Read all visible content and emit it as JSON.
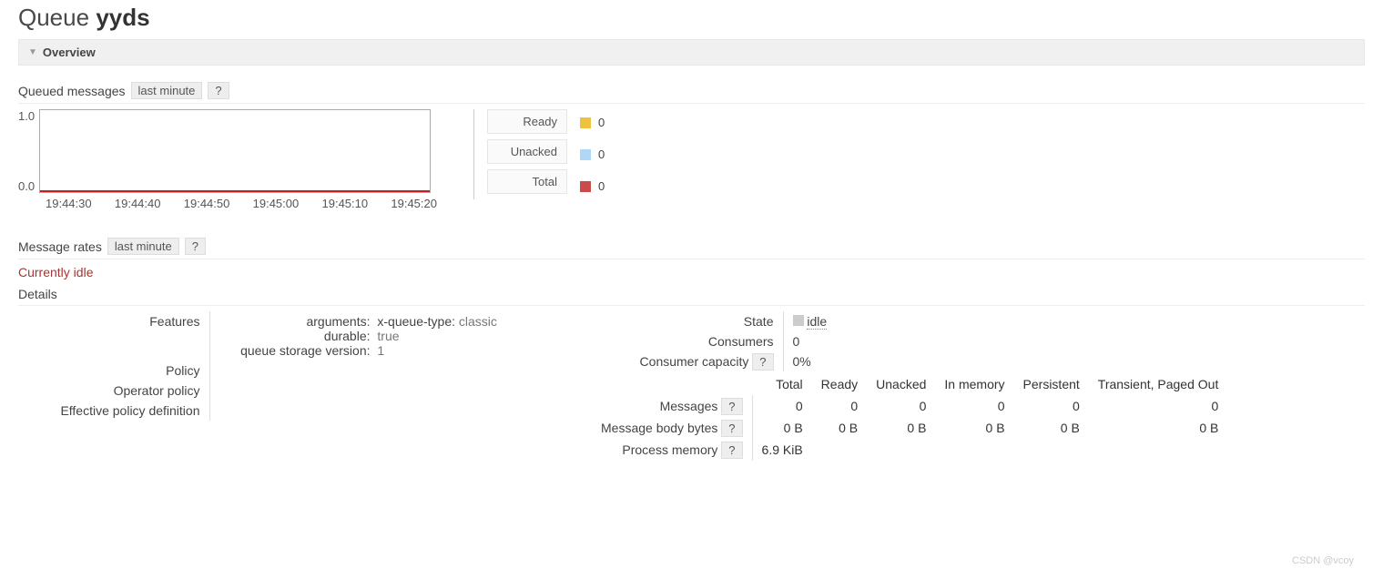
{
  "page": {
    "title_prefix": "Queue",
    "queue_name": "yyds",
    "section_overview": "Overview"
  },
  "queued_messages": {
    "label": "Queued messages",
    "range": "last minute",
    "help": "?"
  },
  "chart_data": {
    "type": "line",
    "title": "Queued messages",
    "xlabel": "",
    "ylabel": "",
    "ylim": [
      0.0,
      1.0
    ],
    "x_ticks": [
      "19:44:30",
      "19:44:40",
      "19:44:50",
      "19:45:00",
      "19:45:10",
      "19:45:20"
    ],
    "y_ticks": [
      "1.0",
      "0.0"
    ],
    "series": [
      {
        "name": "Ready",
        "color": "#edc240",
        "values": [
          0,
          0,
          0,
          0,
          0,
          0
        ],
        "current": "0"
      },
      {
        "name": "Unacked",
        "color": "#afd8f8",
        "values": [
          0,
          0,
          0,
          0,
          0,
          0
        ],
        "current": "0"
      },
      {
        "name": "Total",
        "color": "#cb4b4b",
        "values": [
          0,
          0,
          0,
          0,
          0,
          0
        ],
        "current": "0"
      }
    ]
  },
  "message_rates": {
    "label": "Message rates",
    "range": "last minute",
    "help": "?",
    "status": "Currently idle"
  },
  "details": {
    "heading": "Details",
    "left": {
      "features_label": "Features",
      "arguments_label": "arguments:",
      "arguments_key": "x-queue-type:",
      "arguments_value": "classic",
      "durable_label": "durable:",
      "durable_value": "true",
      "storage_label": "queue storage version:",
      "storage_value": "1",
      "policy_label": "Policy",
      "operator_policy_label": "Operator policy",
      "effective_policy_label": "Effective policy definition"
    },
    "right_top": {
      "state_label": "State",
      "state_value": "idle",
      "consumers_label": "Consumers",
      "consumers_value": "0",
      "capacity_label": "Consumer capacity",
      "capacity_help": "?",
      "capacity_value": "0%"
    },
    "stats": {
      "cols": [
        "Total",
        "Ready",
        "Unacked",
        "In memory",
        "Persistent",
        "Transient, Paged Out"
      ],
      "rows": [
        {
          "label": "Messages",
          "help": "?",
          "vals": [
            "0",
            "0",
            "0",
            "0",
            "0",
            "0"
          ]
        },
        {
          "label": "Message body bytes",
          "help": "?",
          "vals": [
            "0 B",
            "0 B",
            "0 B",
            "0 B",
            "0 B",
            "0 B"
          ]
        },
        {
          "label": "Process memory",
          "help": "?",
          "vals": [
            "6.9 KiB",
            "",
            "",
            "",
            "",
            ""
          ]
        }
      ]
    }
  },
  "watermark": "CSDN @vcoy"
}
